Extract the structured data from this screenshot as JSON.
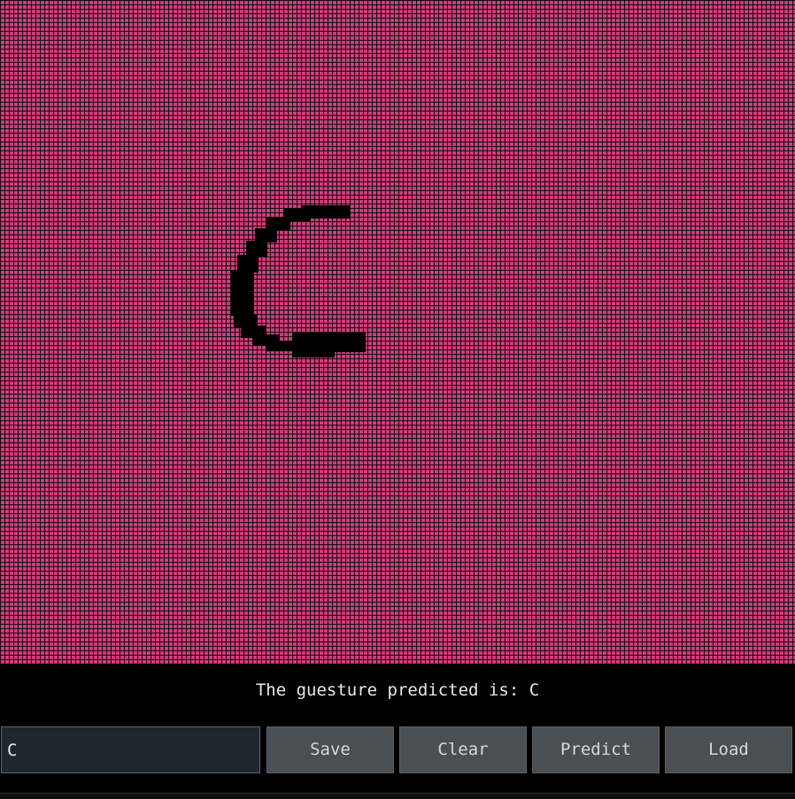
{
  "canvas": {
    "grid_color": "#cc3d7a",
    "stroke_color": "#000000",
    "drawn_gesture": "C"
  },
  "prediction": {
    "text": "The guesture predicted is: C"
  },
  "controls": {
    "label_input_value": "C",
    "save_label": "Save",
    "clear_label": "Clear",
    "predict_label": "Predict",
    "load_label": "Load"
  }
}
